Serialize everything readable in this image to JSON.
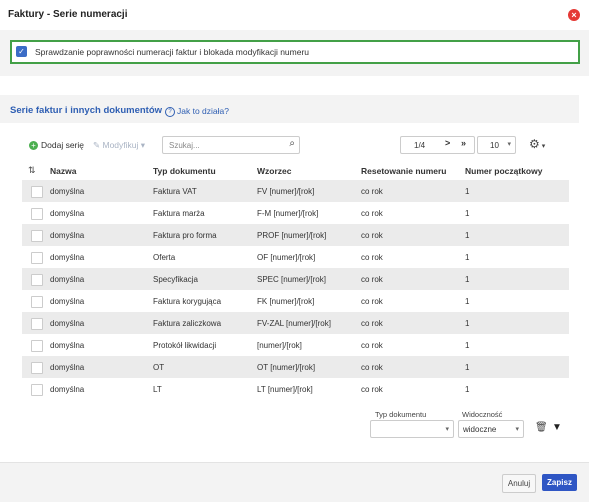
{
  "dialog": {
    "title": "Faktury - Serie numeracji"
  },
  "validation": {
    "label": "Sprawdzanie poprawności numeracji faktur i blokada modyfikacji numeru",
    "checked": true
  },
  "section": {
    "title": "Serie faktur i innych dokumentów",
    "help_label": "Jak to działa?"
  },
  "toolbar": {
    "add_label": "Dodaj serię",
    "edit_label": "Modyfikuj",
    "search_placeholder": "Szukaj...",
    "page_position": "1/4",
    "next_label": ">",
    "last_label": "»",
    "per_page": "10"
  },
  "table": {
    "columns": [
      "Nazwa",
      "Typ dokumentu",
      "Wzorzec",
      "Resetowanie numeru",
      "Numer początkowy"
    ],
    "rows": [
      [
        "domyślna",
        "Faktura VAT",
        "FV [numer]/[rok]",
        "co rok",
        "1"
      ],
      [
        "domyślna",
        "Faktura marża",
        "F-M [numer]/[rok]",
        "co rok",
        "1"
      ],
      [
        "domyślna",
        "Faktura pro forma",
        "PROF [numer]/[rok]",
        "co rok",
        "1"
      ],
      [
        "domyślna",
        "Oferta",
        "OF [numer]/[rok]",
        "co rok",
        "1"
      ],
      [
        "domyślna",
        "Specyfikacja",
        "SPEC [numer]/[rok]",
        "co rok",
        "1"
      ],
      [
        "domyślna",
        "Faktura korygująca",
        "FK [numer]/[rok]",
        "co rok",
        "1"
      ],
      [
        "domyślna",
        "Faktura zaliczkowa",
        "FV-ZAL [numer]/[rok]",
        "co rok",
        "1"
      ],
      [
        "domyślna",
        "Protokół likwidacji",
        "[numer]/[rok]",
        "co rok",
        "1"
      ],
      [
        "domyślna",
        "OT",
        "OT [numer]/[rok]",
        "co rok",
        "1"
      ],
      [
        "domyślna",
        "LT",
        "LT [numer]/[rok]",
        "co rok",
        "1"
      ]
    ]
  },
  "filters": {
    "doc_type_label": "Typ dokumentu",
    "doc_type_value": "",
    "visibility_label": "Widoczność",
    "visibility_value": "widoczne"
  },
  "footer": {
    "cancel_label": "Anuluj",
    "save_label": "Zapisz"
  },
  "colors": {
    "accent": "#2f56c4",
    "highlight_border": "#43a047",
    "close": "#e53935"
  }
}
